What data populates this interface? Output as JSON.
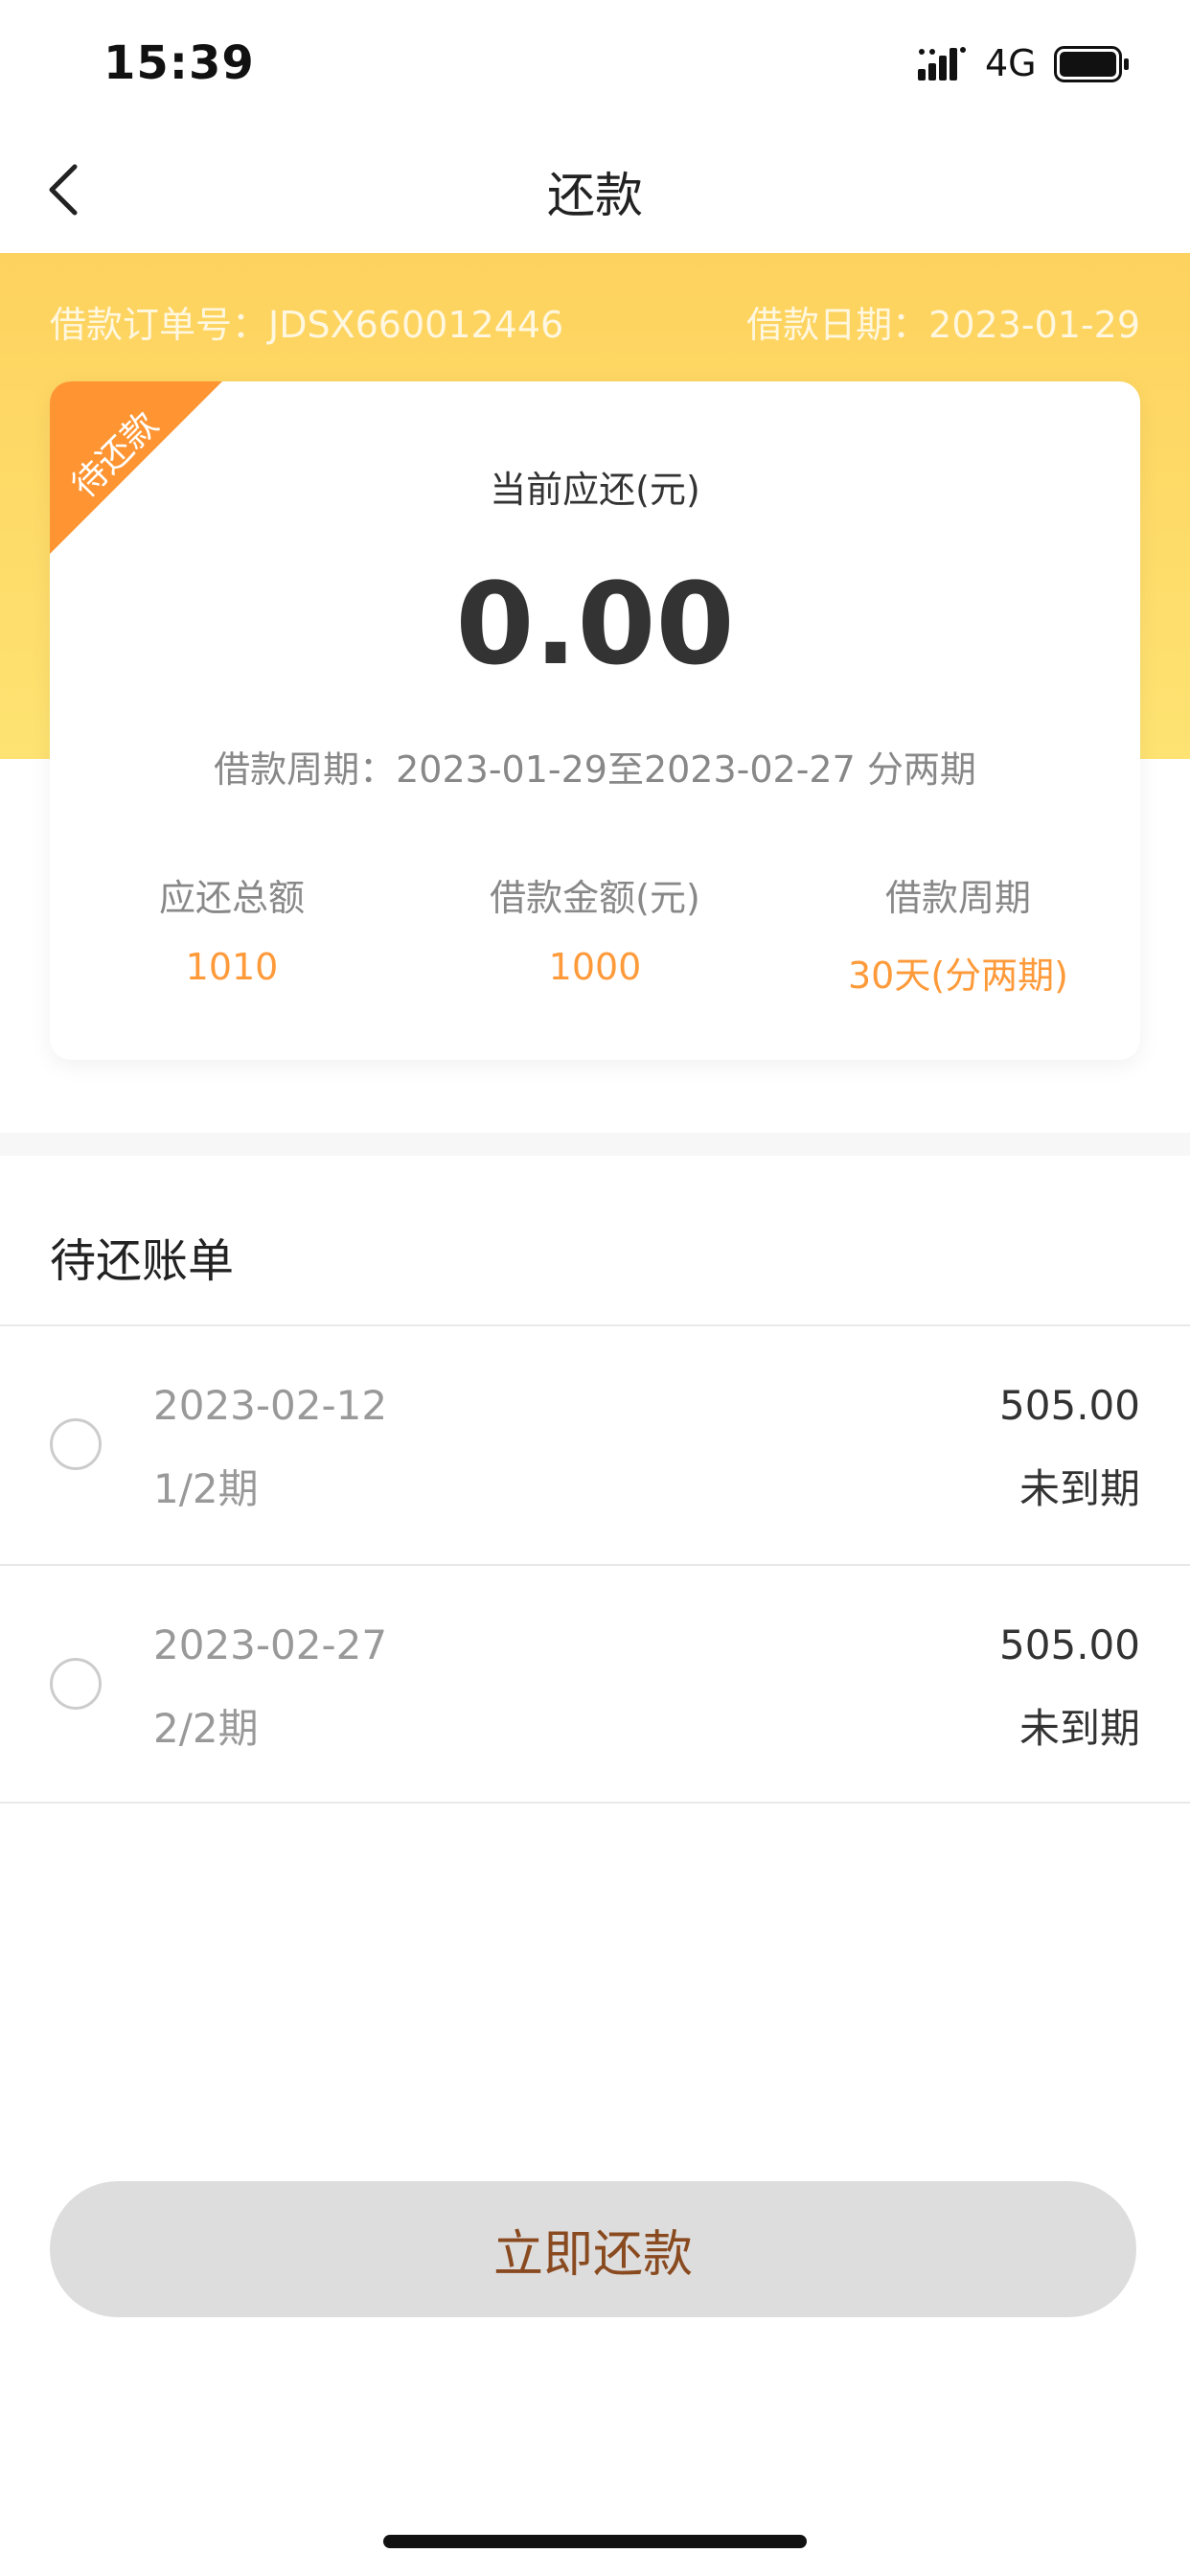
{
  "status_bar": {
    "time": "15:39",
    "network": "4G"
  },
  "nav": {
    "title": "还款"
  },
  "header": {
    "order_no": "借款订单号：JDSX660012446",
    "loan_date": "借款日期：2023-01-29"
  },
  "card": {
    "ribbon": "待还款",
    "current_label": "当前应还(元)",
    "current_amount": "0.00",
    "period_line": "借款周期：2023-01-29至2023-02-27 分两期",
    "stats": [
      {
        "label": "应还总额",
        "value": "1010"
      },
      {
        "label": "借款金额(元)",
        "value": "1000"
      },
      {
        "label": "借款周期",
        "value": "30天(分两期)"
      }
    ]
  },
  "bills": {
    "title": "待还账单",
    "items": [
      {
        "date": "2023-02-12",
        "term": "1/2期",
        "amount": "505.00",
        "status": "未到期"
      },
      {
        "date": "2023-02-27",
        "term": "2/2期",
        "amount": "505.00",
        "status": "未到期"
      }
    ]
  },
  "action": {
    "repay_label": "立即还款"
  },
  "colors": {
    "band_top": "#fed25e",
    "band_bottom": "#fee372",
    "ribbon": "#fe9532",
    "stat_value": "#fe9a3a",
    "button_bg": "#dddddd",
    "button_text": "#8a4a20"
  },
  "icons": [
    "signal-icon",
    "battery-icon",
    "back-arrow-icon",
    "radio-unchecked-icon"
  ]
}
